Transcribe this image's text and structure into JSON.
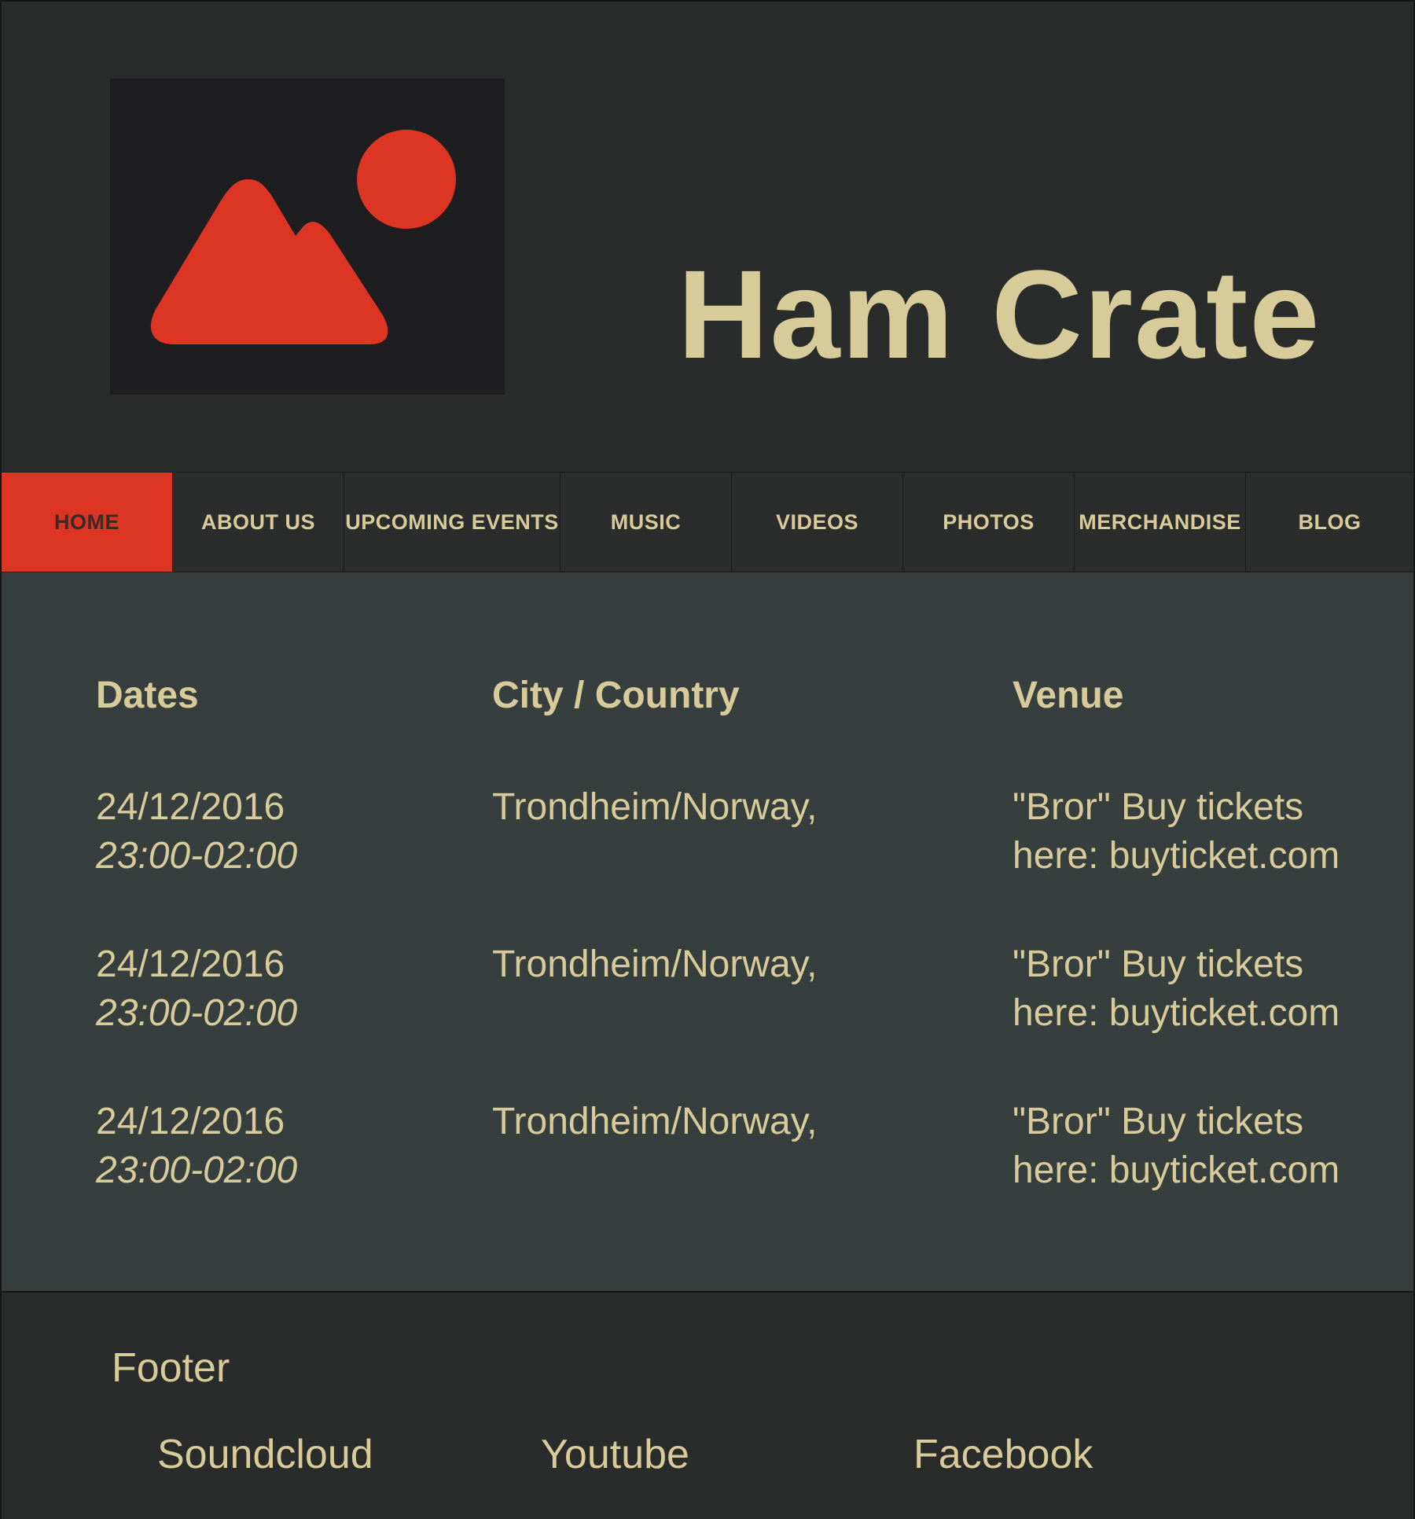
{
  "header": {
    "logo_icon": "image-placeholder-icon",
    "title": "Ham Crate"
  },
  "nav": {
    "items": [
      {
        "label": "HOME",
        "active": true
      },
      {
        "label": "ABOUT US",
        "active": false
      },
      {
        "label": "UPCOMING EVENTS",
        "active": false
      },
      {
        "label": "MUSIC",
        "active": false
      },
      {
        "label": "VIDEOS",
        "active": false
      },
      {
        "label": "PHOTOS",
        "active": false
      },
      {
        "label": "MERCHANDISE",
        "active": false
      },
      {
        "label": "BLOG",
        "active": false
      }
    ]
  },
  "events": {
    "headers": {
      "dates": "Dates",
      "city": "City / Country",
      "venue": "Venue"
    },
    "rows": [
      {
        "date": "24/12/2016",
        "time": "23:00-02:00",
        "city": "Trondheim/Norway,",
        "venue_line1": "\"Bror\" Buy tickets",
        "venue_line2": "here: buyticket.com"
      },
      {
        "date": "24/12/2016",
        "time": "23:00-02:00",
        "city": "Trondheim/Norway,",
        "venue_line1": "\"Bror\" Buy tickets",
        "venue_line2": "here: buyticket.com"
      },
      {
        "date": "24/12/2016",
        "time": "23:00-02:00",
        "city": "Trondheim/Norway,",
        "venue_line1": "\"Bror\" Buy tickets",
        "venue_line2": "here: buyticket.com"
      }
    ]
  },
  "footer": {
    "title": "Footer",
    "links": [
      "Soundcloud",
      "Youtube",
      "Facebook"
    ]
  },
  "colors": {
    "accent": "#dc3524",
    "text": "#d7cb9a",
    "header_bg": "#2a2b2b",
    "main_bg": "#373f3e",
    "logo_bg": "#1e1e21"
  }
}
